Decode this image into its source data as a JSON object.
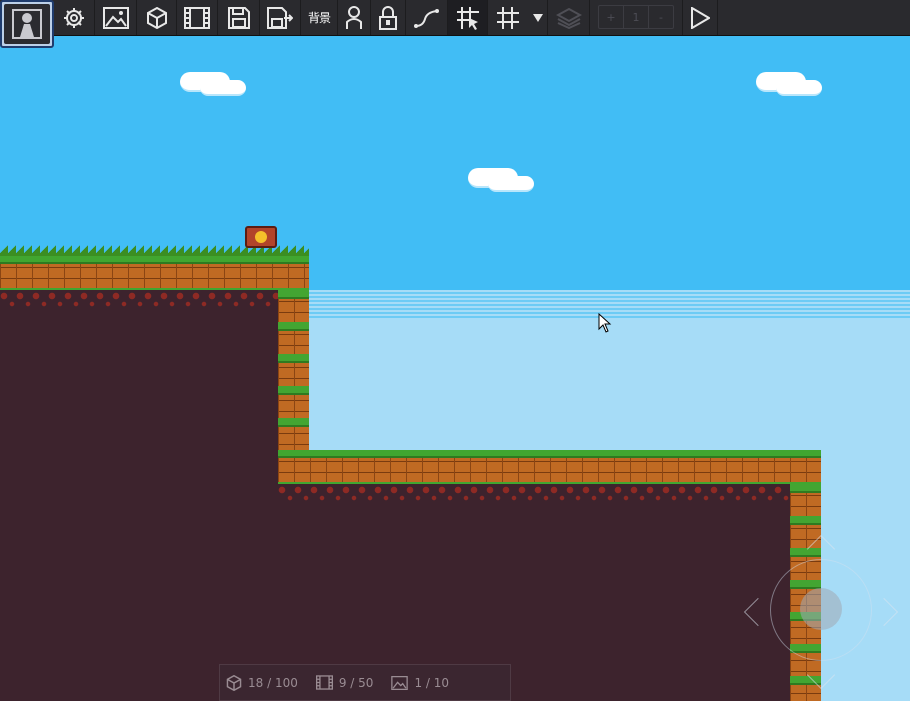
{
  "toolbar": {
    "background_label": "背景",
    "layer_stepper": {
      "decrement": "+",
      "value": "1",
      "increment": "-"
    },
    "icons": [
      "logo-icon",
      "settings-icon",
      "image-icon",
      "cube-icon",
      "film-icon",
      "save-icon",
      "export-icon",
      "background-text",
      "person-icon",
      "lock-icon",
      "path-icon",
      "grid-select-icon",
      "grid-icon",
      "dropdown-arrow-icon",
      "layers-icon",
      "play-icon"
    ]
  },
  "status": {
    "objects": "18 / 100",
    "animations": "9 / 50",
    "images": "1 / 10"
  },
  "colors": {
    "sky": "#41bdf5",
    "sky_light": "#a6dcf7",
    "dirt": "#3d232d",
    "toolbar": "#2a2a2e"
  }
}
